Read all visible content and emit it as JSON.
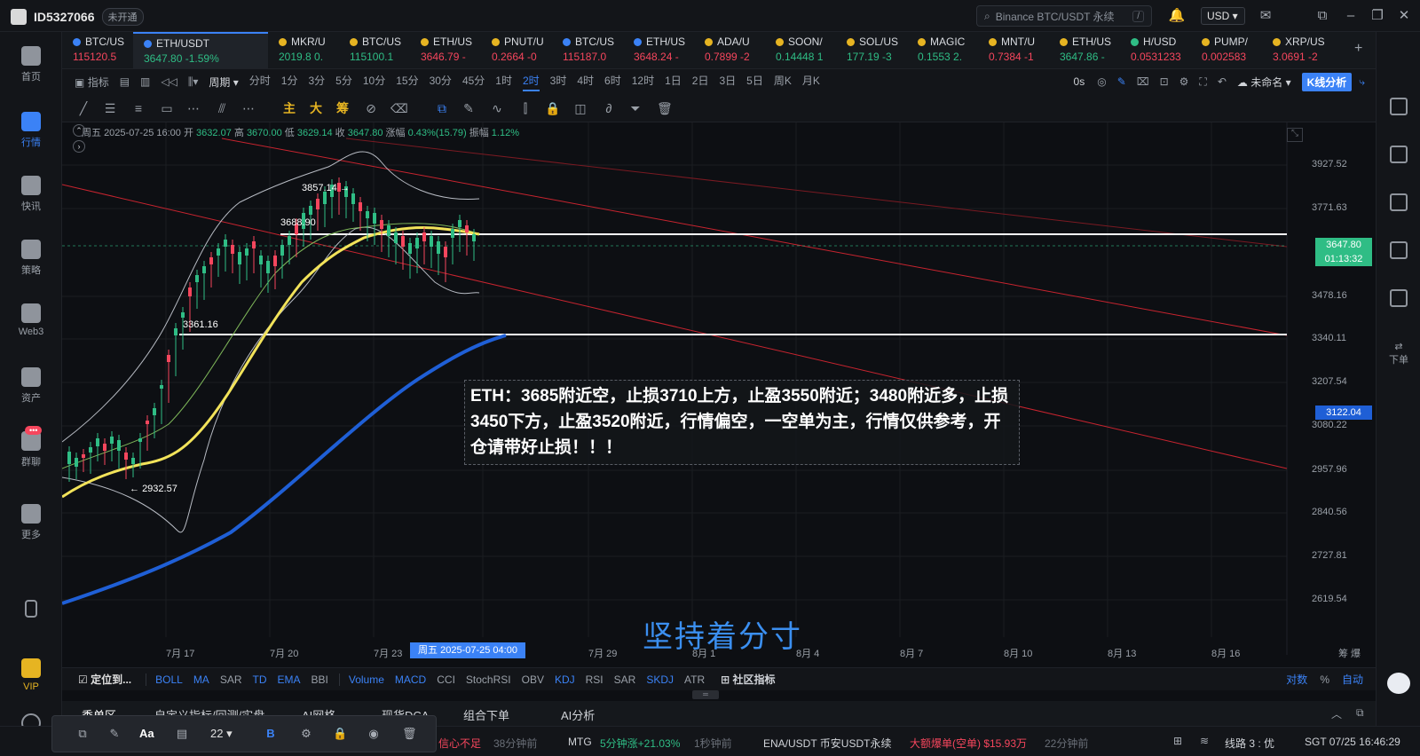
{
  "titlebar": {
    "user_id": "ID5327066",
    "badge": "未开通",
    "search_placeholder": "Binance BTC/USDT 永续",
    "search_hotkey": "/",
    "currency": "USD"
  },
  "nav": [
    {
      "label": "首页",
      "icon": "home-icon"
    },
    {
      "label": "行情",
      "icon": "chart-bars-icon",
      "active": true
    },
    {
      "label": "快讯",
      "icon": "news-icon"
    },
    {
      "label": "策略",
      "icon": "robot-icon"
    },
    {
      "label": "Web3",
      "icon": "web3-icon"
    },
    {
      "label": "资产",
      "icon": "wallet-icon"
    },
    {
      "label": "群聊",
      "icon": "chat-icon",
      "badge": "•••"
    },
    {
      "label": "更多",
      "icon": "grid-icon"
    },
    {
      "label": "VIP",
      "icon": "vip-icon"
    }
  ],
  "tabs": [
    {
      "name": "BTC/US",
      "price": "115120.5",
      "dir": "dn"
    },
    {
      "name": "ETH/USDT",
      "price": "3647.80",
      "change": "-1.59%",
      "dir": "up",
      "active": true
    },
    {
      "name": "MKR/U",
      "price": "2019.8",
      "change": "0.",
      "dir": "up"
    },
    {
      "name": "BTC/US",
      "price": "115100.1",
      "dir": "up"
    },
    {
      "name": "ETH/US",
      "price": "3646.79",
      "change": "-",
      "dir": "dn"
    },
    {
      "name": "PNUT/U",
      "price": "0.2664",
      "change": "-0",
      "dir": "dn"
    },
    {
      "name": "BTC/US",
      "price": "115187.0",
      "dir": "dn"
    },
    {
      "name": "ETH/US",
      "price": "3648.24",
      "change": "-",
      "dir": "dn"
    },
    {
      "name": "ADA/U",
      "price": "0.7899",
      "change": "-2",
      "dir": "dn"
    },
    {
      "name": "SOON/",
      "price": "0.14448",
      "change": "1",
      "dir": "up"
    },
    {
      "name": "SOL/US",
      "price": "177.19",
      "change": "-3",
      "dir": "up"
    },
    {
      "name": "MAGIC",
      "price": "0.1553",
      "change": "2.",
      "dir": "up"
    },
    {
      "name": "MNT/U",
      "price": "0.7384",
      "change": "-1",
      "dir": "dn"
    },
    {
      "name": "ETH/US",
      "price": "3647.86",
      "change": "-",
      "dir": "up"
    },
    {
      "name": "H/USD",
      "price": "0.0531233",
      "dir": "dn"
    },
    {
      "name": "PUMP/",
      "price": "0.002583",
      "dir": "dn"
    },
    {
      "name": "XRP/US",
      "price": "3.0691",
      "change": "-2",
      "dir": "dn"
    }
  ],
  "toolbar": {
    "indicators": "指标",
    "period": "周期",
    "timeframes": [
      "分时",
      "1分",
      "3分",
      "5分",
      "10分",
      "15分",
      "30分",
      "45分",
      "1时",
      "2时",
      "3时",
      "4时",
      "6时",
      "12时",
      "1日",
      "2日",
      "3日",
      "5日",
      "周K",
      "月K"
    ],
    "active_tf": "2时",
    "zero": "0s",
    "layout_name": "未命名",
    "kline_analysis": "K线分析"
  },
  "drawbar": {
    "main": "主",
    "big": "大",
    "chip": "筹"
  },
  "legend": {
    "day": "周五",
    "datetime": "2025-07-25 16:00",
    "open_l": "开",
    "open": "3632.07",
    "high_l": "高",
    "high": "3670.00",
    "low_l": "低",
    "low": "3629.14",
    "close_l": "收",
    "close": "3647.80",
    "chg_l": "涨幅",
    "chg": "0.43%(15.79)",
    "amp_l": "振幅",
    "amp": "1.12%"
  },
  "price_axis": [
    "3927.52",
    "3771.63",
    "3478.16",
    "3340.11",
    "3207.54",
    "3080.22",
    "2957.96",
    "2840.56",
    "2727.81",
    "2619.54"
  ],
  "price_tags": {
    "last": "3647.80",
    "countdown": "01:13:32",
    "ma": "3122.04"
  },
  "annotations": {
    "high": "3857.14",
    "mid": "3688.90",
    "level": "3361.16",
    "low": "2932.57",
    "note": "ETH：3685附近空，止损3710上方，止盈3550附近；3480附近多，止损3450下方，止盈3520附近，行情偏空，一空单为主，行情仅供参考，开仓请带好止损！！！",
    "watermark": "坚持着分寸"
  },
  "x_axis": [
    "7月 17",
    "7月 20",
    "7月 23",
    "7月 29",
    "8月 1",
    "8月 4",
    "8月 7",
    "8月 10",
    "8月 13",
    "8月 16"
  ],
  "x_tag": "周五 2025-07-25 04:00",
  "x_right": "筹 爆",
  "indicators": {
    "locate": "定位到...",
    "main": [
      "BOLL",
      "MA",
      "SAR",
      "TD",
      "EMA",
      "BBI"
    ],
    "sub": [
      "Volume",
      "MACD",
      "CCI",
      "StochRSI",
      "OBV",
      "KDJ",
      "RSI",
      "SAR",
      "SKDJ",
      "ATR"
    ],
    "community": "社区指标",
    "log": "对数",
    "pct": "%",
    "auto": "自动"
  },
  "bottom_tabs": [
    "委单区",
    "自定义指标/回测/实盘",
    "AI网格",
    "现货DCA",
    "组合下单",
    "AI分析"
  ],
  "status": {
    "s1": "信心不足",
    "t1": "38分钟前",
    "coin": "MTG",
    "coin_info": "5分钟涨+21.03%",
    "t2": "1秒钟前",
    "pair": "ENA/USDT 币安USDT永续",
    "liq": "大额爆单(空单) $15.93万",
    "t3": "22分钟前",
    "line": "线路 3 : 优",
    "clock": "SGT 07/25 16:46:29"
  },
  "float_tool": {
    "font_size": "22",
    "bold": "B"
  },
  "colors": {
    "accent": "#3b82f6",
    "up": "#2fbd85",
    "down": "#f6465d",
    "ma_yellow": "#f2e35a",
    "ma_blue": "#1f5fd6"
  }
}
